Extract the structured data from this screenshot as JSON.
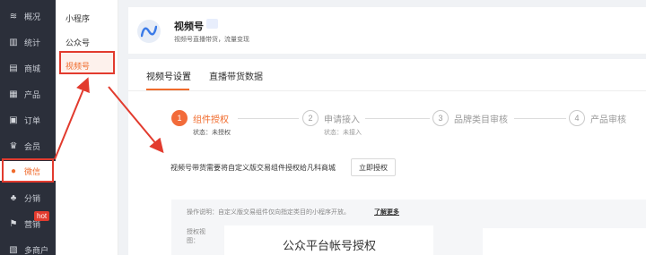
{
  "sidebar": {
    "items": [
      {
        "label": "概况",
        "icon": "overview-icon",
        "glyph": "≋"
      },
      {
        "label": "统计",
        "icon": "stats-icon",
        "glyph": "▥"
      },
      {
        "label": "商城",
        "icon": "mall-icon",
        "glyph": "▤"
      },
      {
        "label": "产品",
        "icon": "product-icon",
        "glyph": "▦"
      },
      {
        "label": "订单",
        "icon": "order-icon",
        "glyph": "▣"
      },
      {
        "label": "会员",
        "icon": "member-icon",
        "glyph": "♛"
      },
      {
        "label": "微信",
        "icon": "wechat-icon",
        "glyph": "●"
      },
      {
        "label": "分销",
        "icon": "distribution-icon",
        "glyph": "♣"
      },
      {
        "label": "营销",
        "icon": "marketing-icon",
        "glyph": "⚑"
      },
      {
        "label": "多商户",
        "icon": "multi-merchant-icon",
        "glyph": "▧"
      }
    ],
    "hot_badge": "hot"
  },
  "subnav": {
    "items": [
      "小程序",
      "公众号",
      "视频号"
    ]
  },
  "header": {
    "title": "视频号",
    "badge": " ",
    "subtitle": "视频号直播带货，流量变现"
  },
  "tabs": [
    "视频号设置",
    "直播带货数据"
  ],
  "steps": [
    {
      "num": "1",
      "title": "组件授权",
      "status": "状态：未授权"
    },
    {
      "num": "2",
      "title": "申请接入",
      "status": "状态：未接入"
    },
    {
      "num": "3",
      "title": "品牌类目审核",
      "status": ""
    },
    {
      "num": "4",
      "title": "产品审核",
      "status": ""
    }
  ],
  "notice": "视频号带货需要将自定义版交易组件授权给凡科商城",
  "auth_button": "立即授权",
  "panel": {
    "desc": "操作说明：自定义版交易组件仅向指定类目的小程序开放。",
    "link": "了解更多",
    "flow_label": "授权视图：",
    "flow_title": "公众平台帐号授权"
  },
  "colors": {
    "accent": "#f06a2b",
    "annotation": "#e23b2e",
    "sidebar_bg": "#2b2f3a"
  }
}
